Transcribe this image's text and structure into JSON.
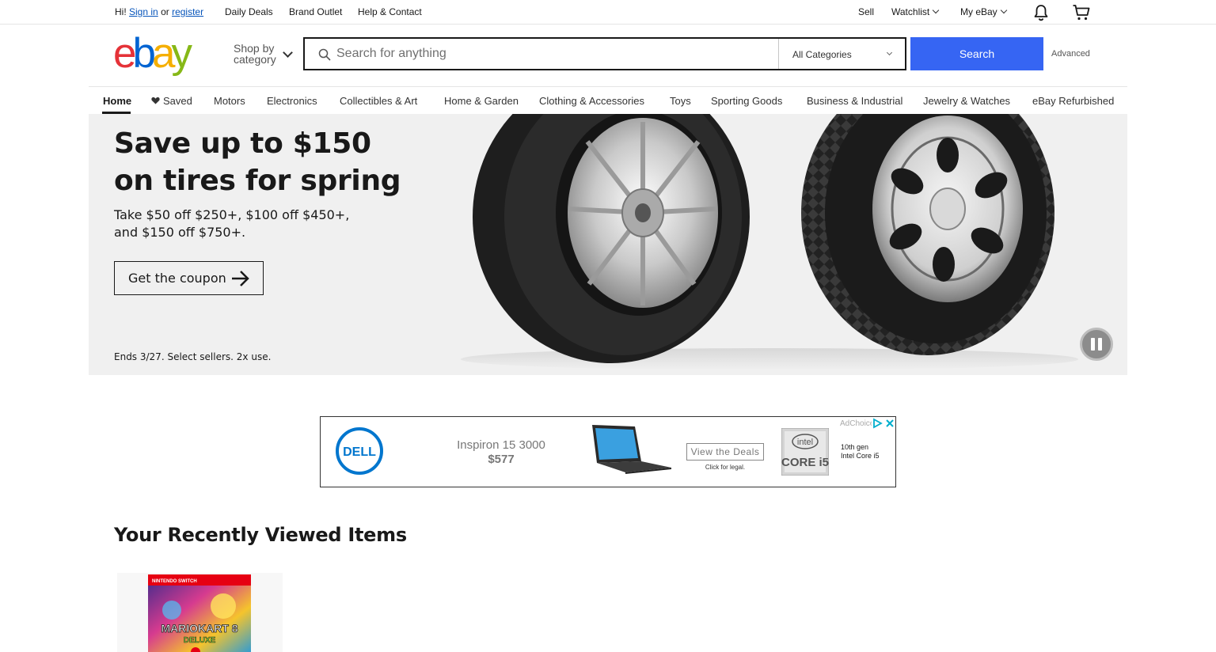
{
  "topbar": {
    "greeting": "Hi!",
    "sign_in": "Sign in",
    "or": "or",
    "register": "register",
    "daily_deals": "Daily Deals",
    "brand_outlet": "Brand Outlet",
    "help_contact": "Help & Contact",
    "sell": "Sell",
    "watchlist": "Watchlist",
    "my_ebay": "My eBay",
    "icons": [
      "bell-icon",
      "cart-icon"
    ]
  },
  "header": {
    "logo_text": "ebay",
    "shop_by": "Shop by",
    "category": "category",
    "search_placeholder": "Search for anything",
    "category_select": "All Categories",
    "search_button": "Search",
    "advanced": "Advanced"
  },
  "nav": {
    "items": [
      {
        "label": "Home"
      },
      {
        "label": "Saved"
      },
      {
        "label": "Motors"
      },
      {
        "label": "Electronics"
      },
      {
        "label": "Collectibles & Art"
      },
      {
        "label": "Home & Garden"
      },
      {
        "label": "Clothing & Accessories"
      },
      {
        "label": "Toys"
      },
      {
        "label": "Sporting Goods"
      },
      {
        "label": "Business & Industrial"
      },
      {
        "label": "Jewelry & Watches"
      },
      {
        "label": "eBay Refurbished"
      }
    ]
  },
  "hero": {
    "title": "Save up to $150 on tires for spring",
    "subtitle": "Take $50 off $250+, $100 off $450+, and $150 off $750+.",
    "cta": "Get the coupon",
    "fine_print": "Ends 3/27. Select sellers. 2x use."
  },
  "ad": {
    "brand": "DELL",
    "model": "Inspiron 15 3000",
    "price": "$577",
    "cta": "View the Deals",
    "legal": "Click for legal.",
    "intel_brand": "intel",
    "intel_badge": "CORE i5",
    "intel_line1": "10th gen",
    "intel_line2": "Intel Core i5",
    "adchoices": "AdChoices"
  },
  "recent": {
    "title": "Your Recently Viewed Items",
    "items": [
      {
        "box_brand": "NINTENDO SWITCH",
        "title_art": "MARIOKART 8",
        "subtitle_art": "DELUXE"
      }
    ]
  },
  "colors": {
    "ebay_red": "#e53238",
    "ebay_blue": "#0064d2",
    "ebay_yellow": "#f5af02",
    "ebay_green": "#86b817",
    "search_button": "#3665f3",
    "hero_bg": "#f0f0f0",
    "link": "#0654ba"
  }
}
